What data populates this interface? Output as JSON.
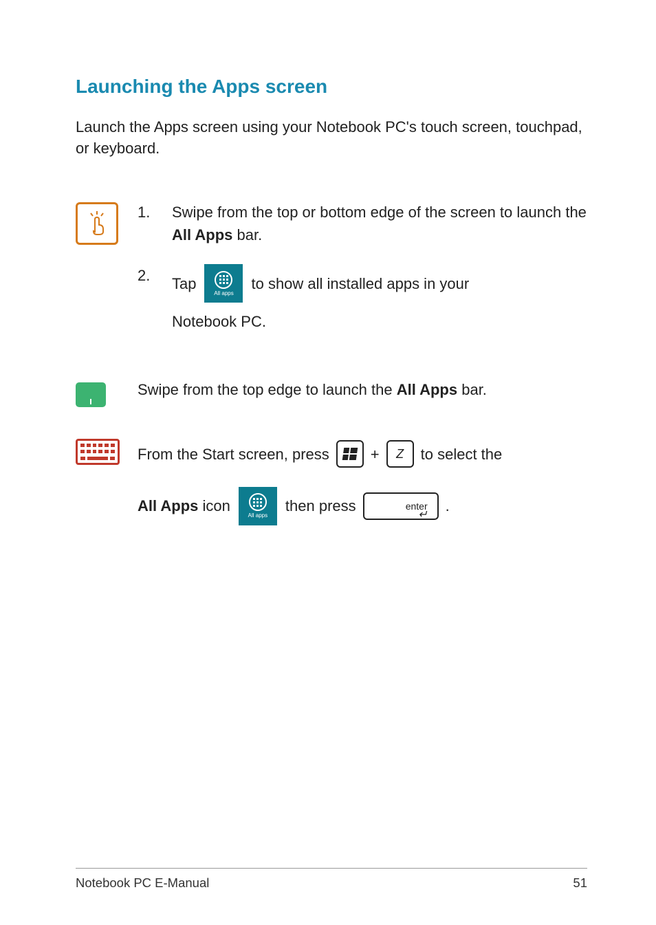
{
  "heading": "Launching the Apps screen",
  "intro": "Launch the Apps screen using your Notebook PC's touch screen, touchpad, or keyboard.",
  "touch": {
    "step1_num": "1.",
    "step1_a": "Swipe from the top or bottom edge of the screen to launch the ",
    "step1_bold": "All Apps",
    "step1_b": " bar.",
    "step2_num": "2.",
    "step2_a": "Tap",
    "step2_b": "to show all installed apps in your",
    "step2_c": "Notebook PC."
  },
  "touchpad": {
    "a": "Swipe from the top edge to launch the ",
    "bold": "All Apps",
    "b": " bar."
  },
  "keyboard": {
    "a": "From the Start screen, press",
    "plus": "+",
    "z": "Z",
    "b": "to select the",
    "bold": "All Apps",
    "c": " icon",
    "d": "then press",
    "period": "."
  },
  "allapps_label": "All apps",
  "enter_text": "enter",
  "footer_left": "Notebook PC E-Manual",
  "footer_right": "51"
}
